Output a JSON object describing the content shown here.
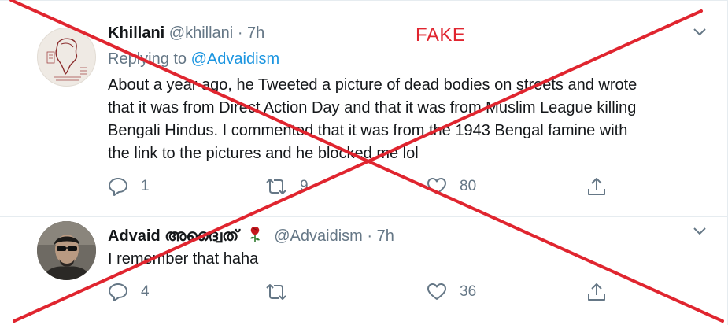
{
  "overlay": {
    "label": "FAKE",
    "color": "#e0252f"
  },
  "tweets": [
    {
      "name": "Khillani",
      "handle": "@khillani",
      "separator": "·",
      "time": "7h",
      "replying_prefix": "Replying to",
      "replying_to": "@Advaidism",
      "lines": [
        "About a year ago, he Tweeted a picture of dead bodies on streets and wrote",
        "that it was from Direct Action Day and that it was from Muslim League killing",
        "Bengali Hindus. I commented that it was from the 1943 Bengal famine with",
        "the link to the pictures and he blocked me lol"
      ],
      "reply_count": "1",
      "retweet_count": "9",
      "like_count": "80",
      "avatar_icon": "map-emblem-avatar"
    },
    {
      "name": "Advaid",
      "name_script": "അദ്വൈത്",
      "emoji": "rose-icon",
      "handle": "@Advaidism",
      "separator": "·",
      "time": "7h",
      "lines": [
        "I remember that haha"
      ],
      "reply_count": "4",
      "retweet_count": "",
      "like_count": "36",
      "avatar_icon": "person-sunglasses-avatar"
    }
  ],
  "colors": {
    "secondary_text": "#657786",
    "link": "#1b95e0",
    "divider": "#e6ecf0"
  }
}
